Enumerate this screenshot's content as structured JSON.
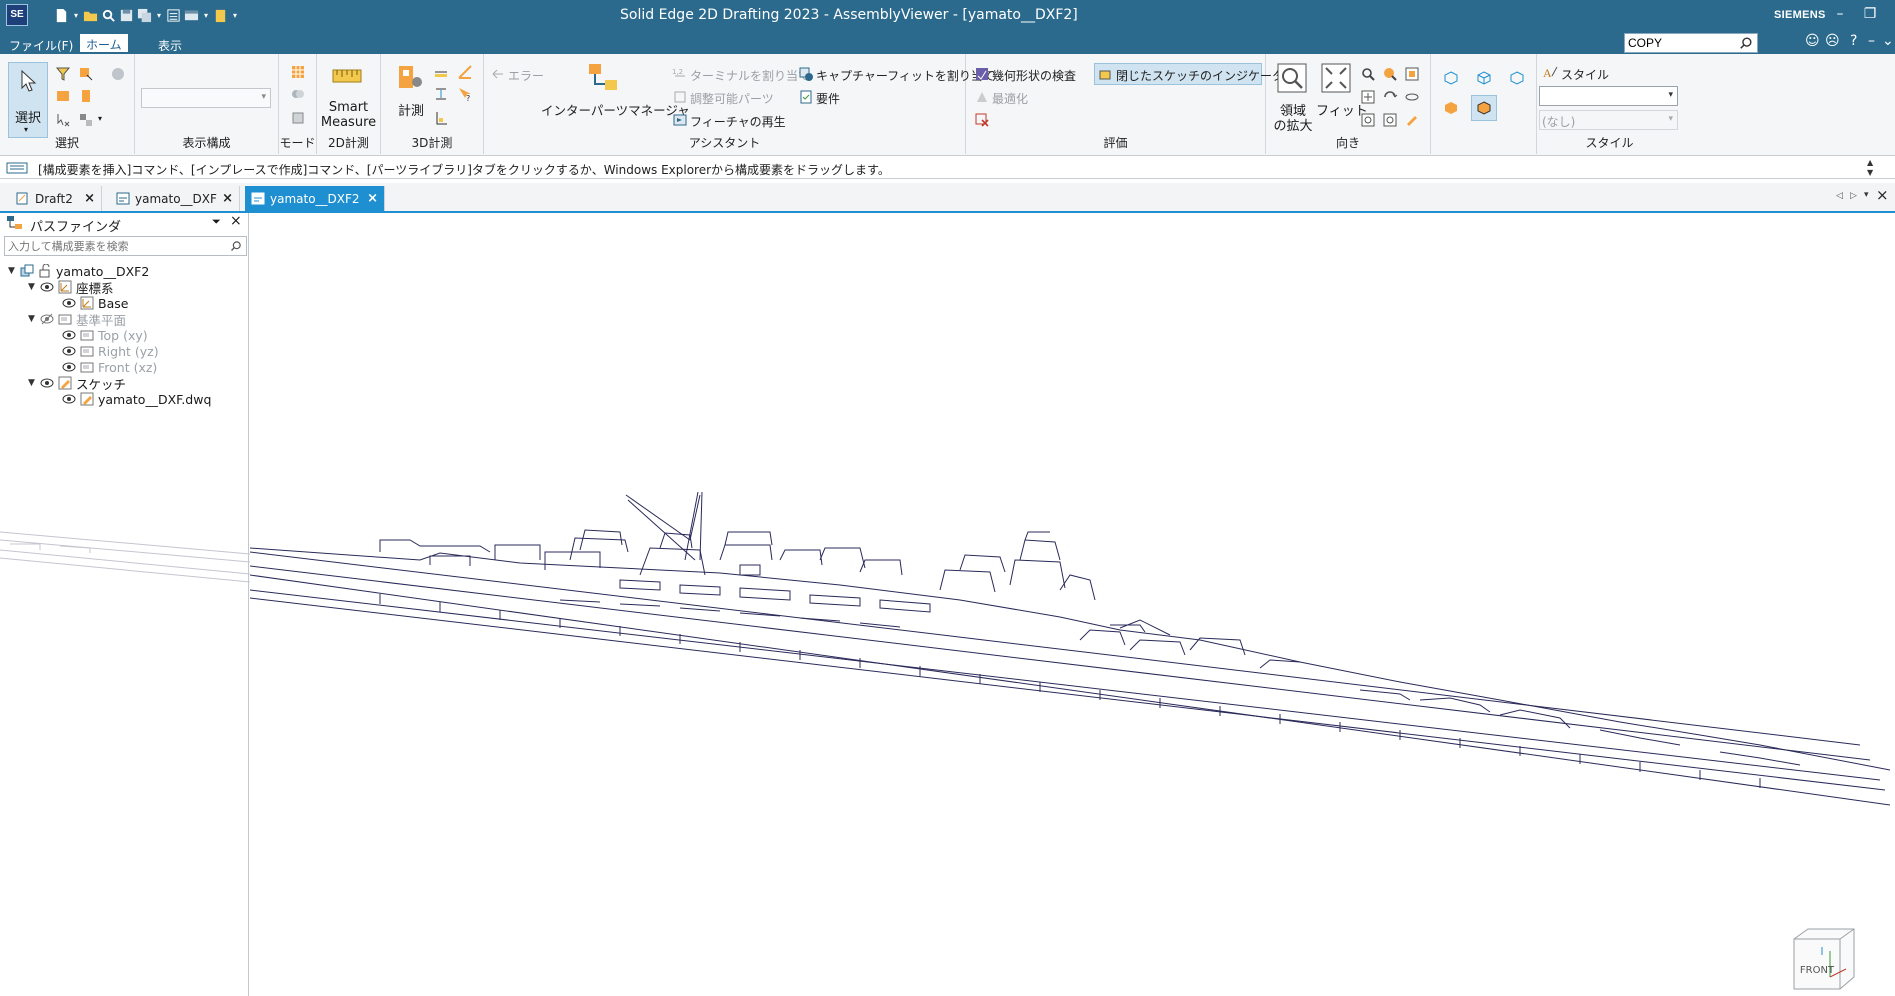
{
  "app": {
    "logo_text": "SE",
    "window_title": "Solid Edge 2D Drafting 2023 - AssemblyViewer - [yamato__DXF2]",
    "brand": "SIEMENS"
  },
  "menu": {
    "file": "ファイル(F)",
    "home": "ホーム",
    "view": "表示"
  },
  "search": {
    "value": "COPY"
  },
  "ribbon": {
    "select_group": {
      "select_label": "選択",
      "group": "選択"
    },
    "display_group": {
      "group": "表示構成"
    },
    "mode_group": {
      "group": "モード"
    },
    "measure2d_group": {
      "line1": "Smart",
      "line2": "Measure",
      "group": "2D計測"
    },
    "measure3d_group": {
      "label": "計測",
      "group": "3D計測"
    },
    "assistant_group": {
      "error": "エラー",
      "interpart": "インターパーツマネージャ",
      "assign_terminal": "ターミナルを割り当て",
      "adjustable_parts": "調整可能パーツ",
      "replay_features": "フィーチャの再生",
      "assign_capture_fit": "キャプチャーフィットを割り当て",
      "requirements": "要件",
      "group": "アシスタント"
    },
    "evaluate_group": {
      "geometry_check": "幾何形状の検査",
      "closed_sketch_indicator": "閉じたスケッチのインジケータ",
      "optimize": "最適化",
      "group": "評価"
    },
    "orient_group": {
      "zoom_area_line1": "領域",
      "zoom_area_line2": "の拡大",
      "fit": "フィット",
      "group": "向き"
    },
    "style_group": {
      "style": "スタイル",
      "style_value": "(なし)",
      "group": "スタイル"
    }
  },
  "prompt": {
    "text": "[構成要素を挿入]コマンド、[インプレースで作成]コマンド、[パーツライブラリ]タブをクリックするか、Windows Explorerから構成要素をドラッグします。"
  },
  "doc_tabs": [
    {
      "label": "Draft2"
    },
    {
      "label": "yamato__DXF"
    },
    {
      "label": "yamato__DXF2"
    }
  ],
  "pathfinder": {
    "title": "パスファインダ",
    "search_placeholder": "入力して構成要素を検索",
    "tree": {
      "root": "yamato__DXF2",
      "coord_sys": "座標系",
      "base": "Base",
      "ref_planes": "基準平面",
      "top": "Top (xy)",
      "right": "Right (yz)",
      "front": "Front (xz)",
      "sketch": "スケッチ",
      "dwg": "yamato__DXF.dwq"
    }
  },
  "viewcube": {
    "label": "FRONT"
  },
  "colors": {
    "titlebar": "#2b6a8c",
    "accent": "#1e8fd0",
    "drawing_line": "#2a2a5a"
  }
}
